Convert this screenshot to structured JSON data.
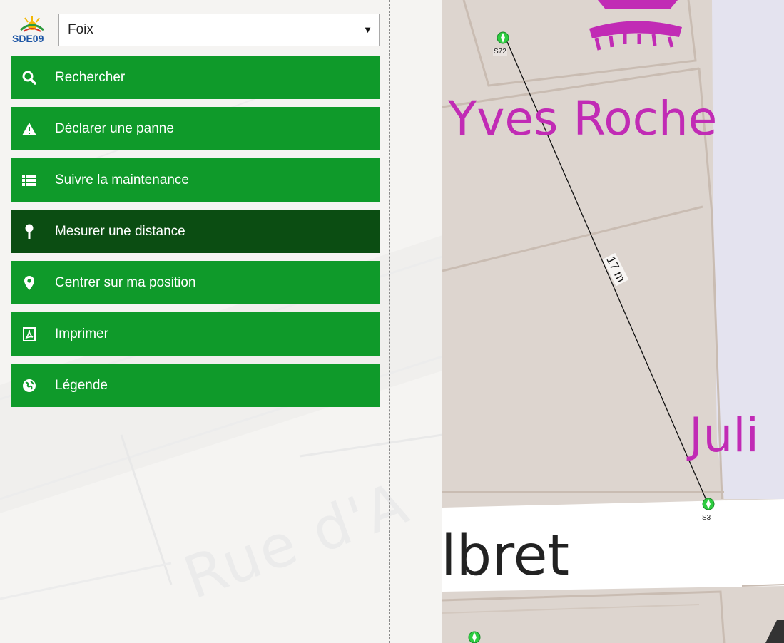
{
  "app": {
    "logo_text": "SDE09"
  },
  "commune_select": {
    "value": "Foix"
  },
  "menu": [
    {
      "id": "search",
      "label": "Rechercher",
      "icon": "search-icon",
      "active": false
    },
    {
      "id": "report",
      "label": "Déclarer une panne",
      "icon": "warning-icon",
      "active": false
    },
    {
      "id": "maintenance",
      "label": "Suivre la maintenance",
      "icon": "list-icon",
      "active": false
    },
    {
      "id": "measure",
      "label": "Mesurer une distance",
      "icon": "pin-icon",
      "active": true
    },
    {
      "id": "locate",
      "label": "Centrer sur ma position",
      "icon": "location-icon",
      "active": false
    },
    {
      "id": "print",
      "label": "Imprimer",
      "icon": "pdf-icon",
      "active": false
    },
    {
      "id": "legend",
      "label": "Légende",
      "icon": "globe-icon",
      "active": false
    }
  ],
  "map": {
    "background_street_label": "Rue d'A",
    "poi_labels": [
      "Yves Roche",
      "Juli"
    ],
    "street_label": "lbret",
    "measurement": {
      "distance_label": "17 m"
    },
    "markers": [
      {
        "id": "S72",
        "label": "S72"
      },
      {
        "id": "S3",
        "label": "S3"
      },
      {
        "id": "marker-bottom",
        "label": ""
      }
    ]
  },
  "colors": {
    "menu_green": "#0f9a2a",
    "menu_active": "#0b4d12",
    "poi_magenta": "#c12bb5",
    "map_building": "#ddd5cf",
    "map_road": "#e6e6f2",
    "marker_green": "#2ecc40"
  }
}
